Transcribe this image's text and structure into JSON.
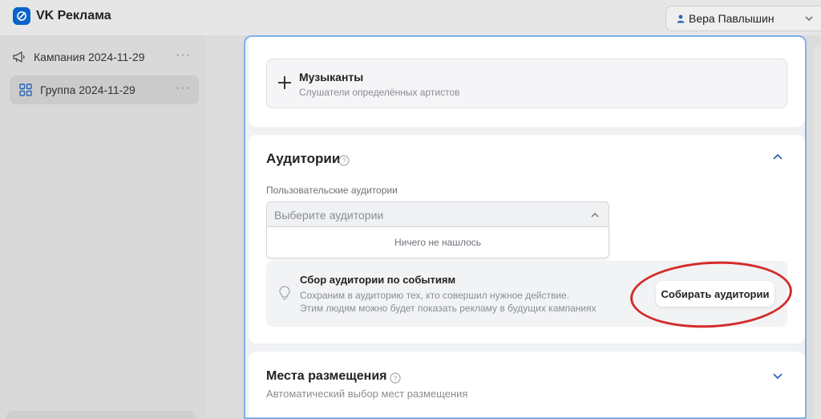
{
  "app": {
    "title": "VK Реклама",
    "accent": "#0a64c8"
  },
  "header": {
    "user_name": "Вера Павлышин"
  },
  "sidebar": {
    "items": [
      {
        "label": "Кампания 2024-11-29",
        "icon": "megaphone-icon",
        "more": "···"
      },
      {
        "label": "Группа 2024-11-29",
        "icon": "grid-icon",
        "more": "···",
        "active": true
      }
    ]
  },
  "musicians": {
    "title": "Музыканты",
    "subtitle": "Слушатели определённых артистов"
  },
  "audiences": {
    "title": "Аудитории",
    "field_label": "Пользовательские аудитории",
    "placeholder": "Выберите аудитории",
    "empty_text": "Ничего не нашлось",
    "events": {
      "title": "Сбор аудитории по событиям",
      "line1": "Сохраним в аудиторию тех, кто совершил нужное действие.",
      "line2": "Этим людям можно будет показать рекламу в будущих кампаниях",
      "button": "Собирать аудитории"
    }
  },
  "placements": {
    "title": "Места размещения",
    "subtitle": "Автоматический выбор мест размещения"
  },
  "annotation_color": "#d42b2b"
}
